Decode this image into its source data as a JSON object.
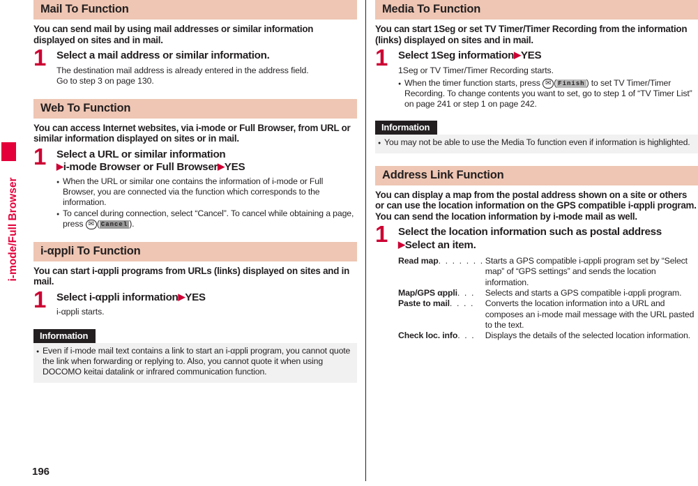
{
  "page": {
    "number": "196",
    "side_tab_label": "i-mode/Full Browser"
  },
  "left_column": {
    "sections": [
      {
        "heading": "Mail To Function",
        "intro": "You can send mail by using mail addresses or similar information displayed on sites and in mail.",
        "step_number": "1",
        "step_title": "Select a mail address or similar information.",
        "body_lines": [
          "The destination mail address is already entered in the address field.",
          "Go to step 3 on page 130."
        ]
      },
      {
        "heading": "Web To Function",
        "intro": "You can access Internet websites, via i-mode or Full Browser, from URL or similar information displayed on sites or in mail.",
        "step_number": "1",
        "step_title_line1": "Select a URL or similar information",
        "step_title_line2_a": "i-mode Browser or Full Browser",
        "step_title_line2_b": "YES",
        "bullets": [
          "When the URL or similar one contains the information of i-mode or Full Browser, you are connected via the function which corresponds to the information.",
          "To cancel during connection, select “Cancel”. To cancel while obtaining a page, press"
        ],
        "cancel_softkey": "Cancel"
      },
      {
        "heading_prefix": "i-",
        "heading_alpha": "α",
        "heading_suffix": "ppli To Function",
        "heading": "i-αppli To Function",
        "intro": "You can start i-αppli programs from URLs (links) displayed on sites and in mail.",
        "step_number": "1",
        "step_title_a": "Select i-αppli information",
        "step_title_b": "YES",
        "body_lines": [
          "i-αppli starts."
        ],
        "information": {
          "title": "Information",
          "items": [
            "Even if i-mode mail text contains a link to start an i-αppli program, you cannot quote the link when forwarding or replying to. Also, you cannot quote it when using DOCOMO keitai datalink or infrared communication function."
          ]
        }
      }
    ]
  },
  "right_column": {
    "sections": [
      {
        "heading": "Media To Function",
        "intro": "You can start 1Seg or set TV Timer/Timer Recording from the information (links) displayed on sites and in mail.",
        "step_number": "1",
        "step_title_a": "Select 1Seg information",
        "step_title_b": "YES",
        "body_lines": [
          "1Seg or TV Timer/Timer Recording starts."
        ],
        "bullet_pre": "When the timer function starts, press",
        "finish_softkey": "Finish",
        "bullet_post": ") to set TV Timer/Timer Recording.",
        "sub_lines": [
          "To change contents you want to set, go to step 1 of “TV Timer List” on page 241 or step 1 on page 242."
        ],
        "information": {
          "title": "Information",
          "items": [
            "You may not be able to use the Media To function even if information is highlighted."
          ]
        }
      },
      {
        "heading": "Address Link Function",
        "intro": "You can display a map from the postal address shown on a site or others or can use the location information on the GPS compatible i-αppli program. You can send the location information by i-mode mail as well.",
        "step_number": "1",
        "step_title_line1": "Select the location information such as postal address",
        "step_title_line2": "Select an item.",
        "options": [
          {
            "term": "Read map",
            "dots": ". . . . . . .",
            "desc_lines": [
              "Starts a GPS compatible i-αppli program set by “Select map”",
              "of “GPS settings” and sends the location information."
            ]
          },
          {
            "term": "Map/GPS αppli",
            "dots": ". . .",
            "desc_lines": [
              "Selects and starts a GPS compatible i-αppli program."
            ]
          },
          {
            "term": "Paste to mail",
            "dots": ". . . .",
            "desc_lines": [
              "Converts the location information into a URL and composes an",
              "i-mode mail message with the URL pasted to the text."
            ]
          },
          {
            "term": "Check loc. info",
            "dots": ". . .",
            "desc_lines": [
              "Displays the details of the selected location information."
            ]
          }
        ]
      }
    ]
  },
  "colors": {
    "section_bar": "#eec6b3",
    "accent_red": "#cc0033",
    "tab_red": "#e4003a",
    "info_head": "#231f20",
    "info_body": "#f1f1f1"
  },
  "icons": {
    "mail_key": "mail-key-icon",
    "arrow": "right-triangle-icon"
  }
}
